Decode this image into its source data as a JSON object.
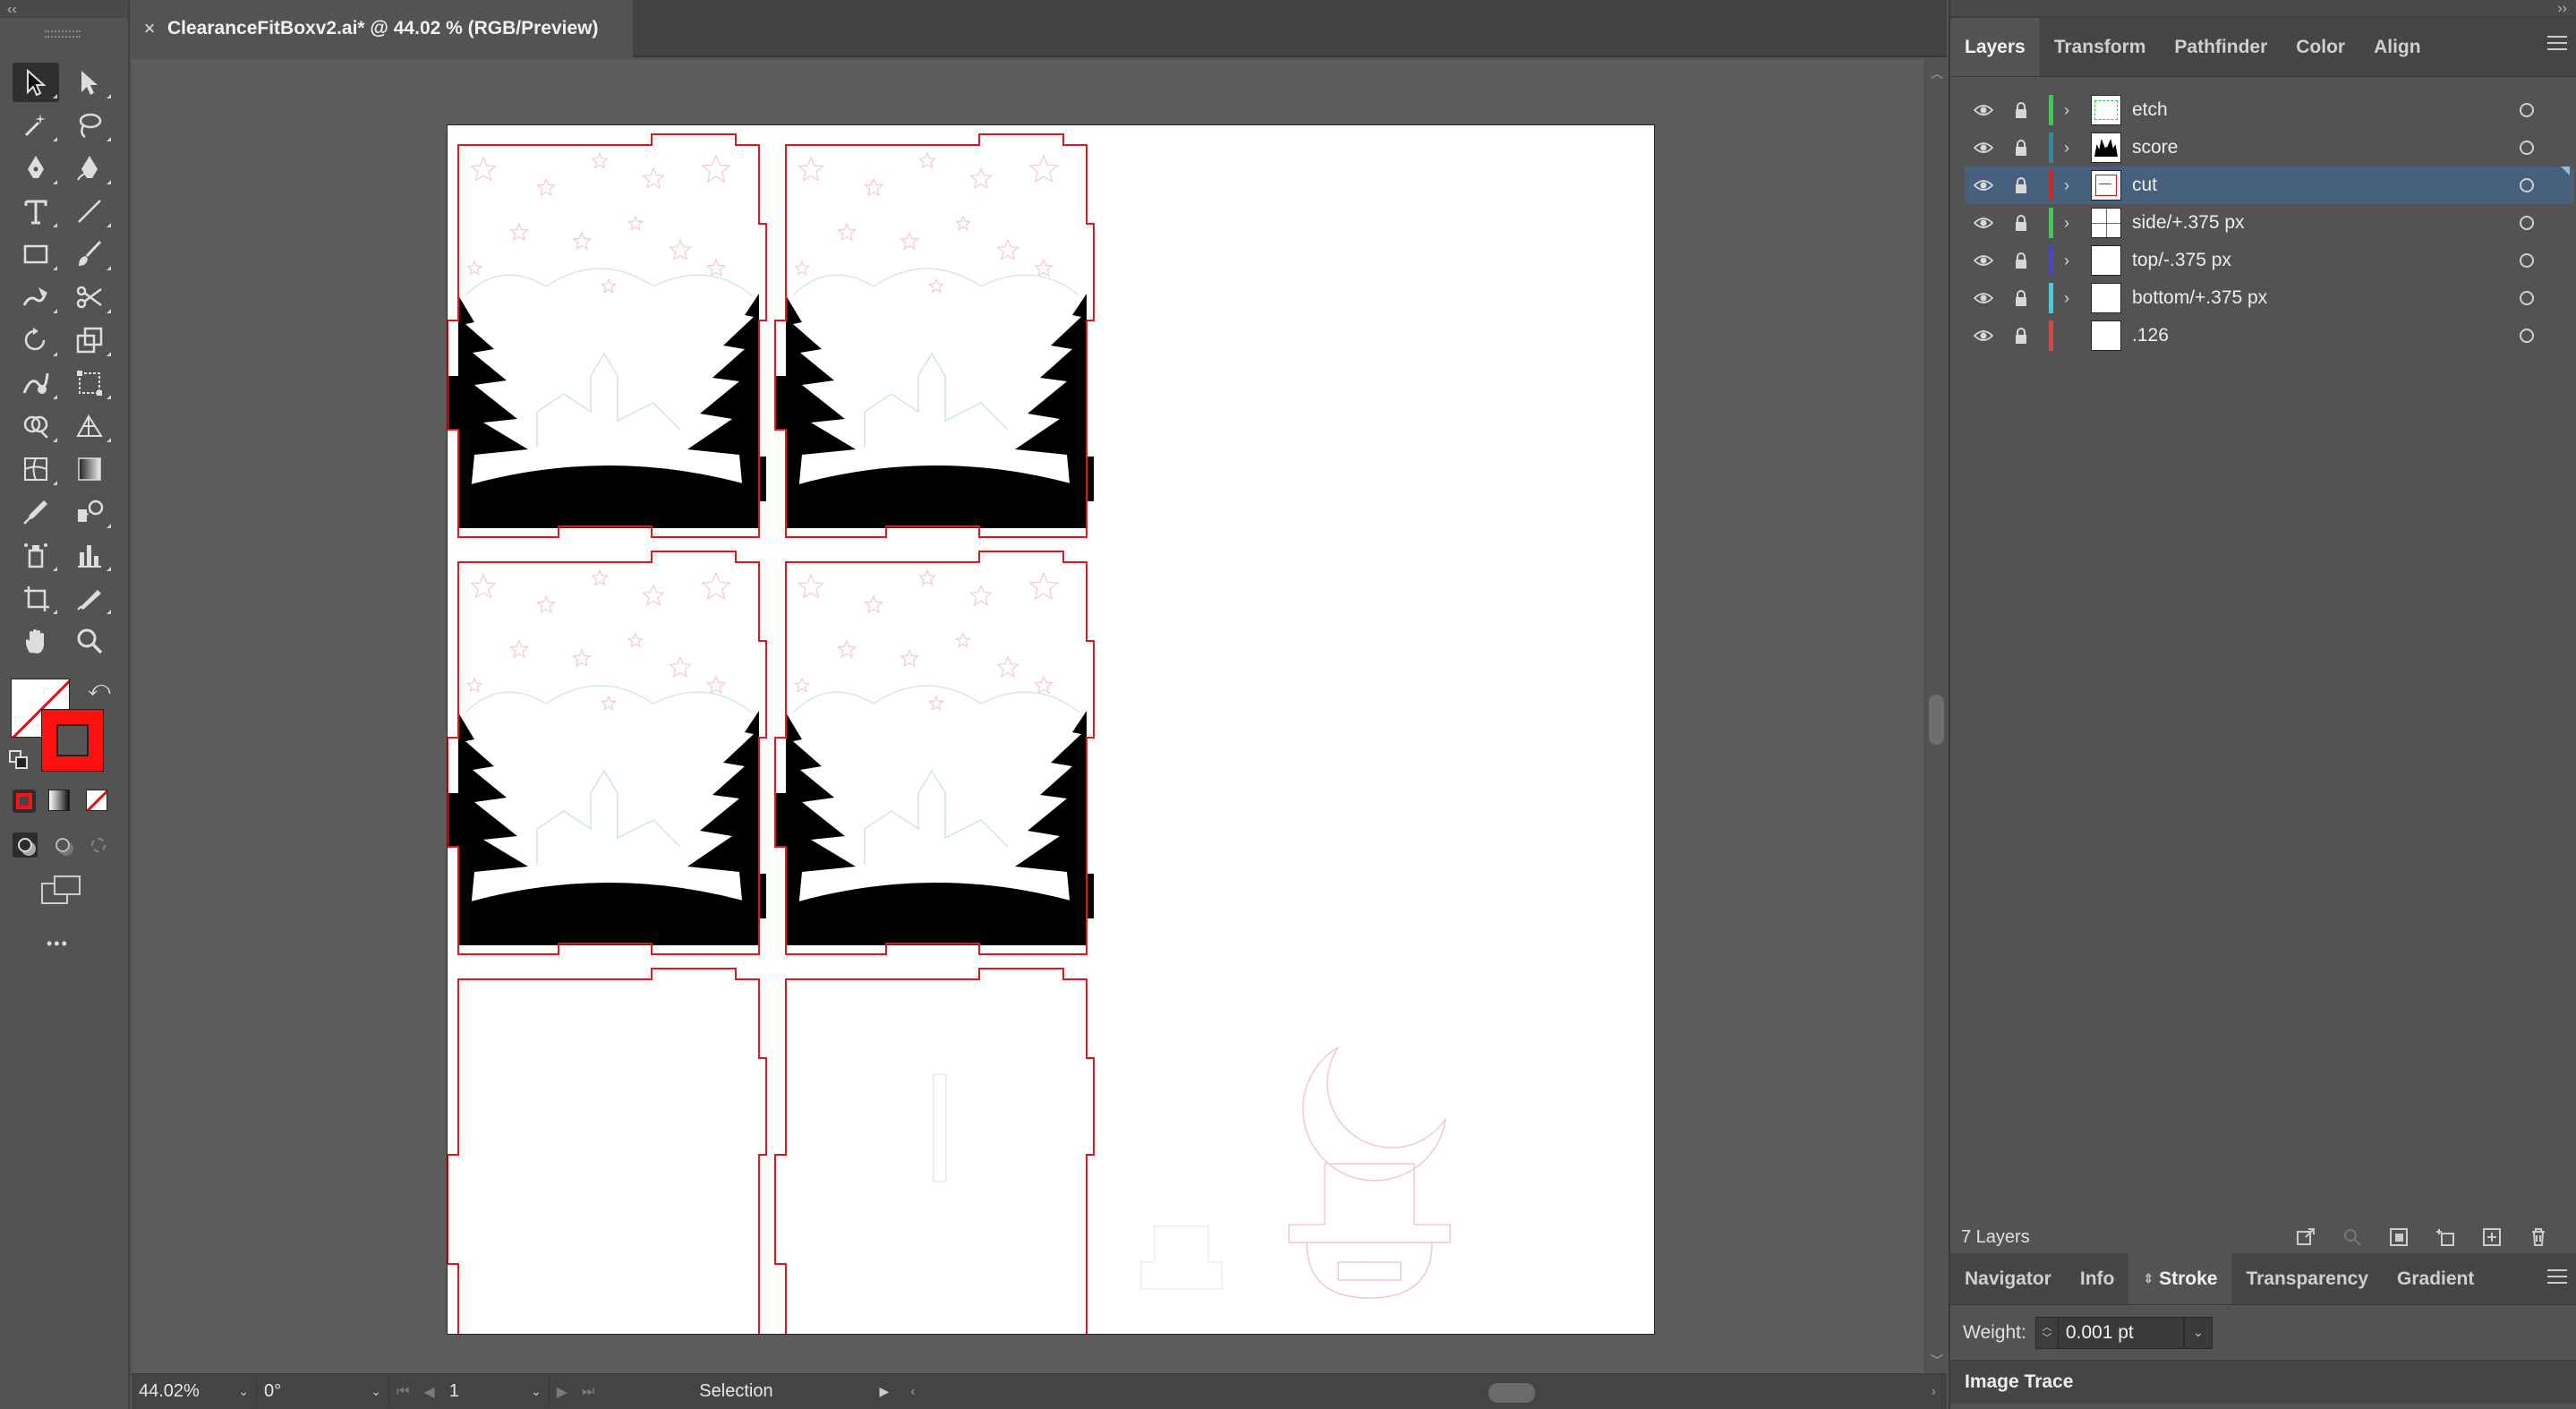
{
  "document": {
    "tab_title": "ClearanceFitBoxv2.ai* @ 44.02 % (RGB/Preview)",
    "close_glyph": "×"
  },
  "window": {
    "left_collapse": "‹‹",
    "right_collapse": "››"
  },
  "statusbar": {
    "zoom": "44.02%",
    "rotation": "0°",
    "artboard_number": "1",
    "mode": "Selection"
  },
  "panels": {
    "top_tabs": [
      "Layers",
      "Transform",
      "Pathfinder",
      "Color",
      "Align"
    ],
    "active_top_tab": "Layers",
    "layers": [
      {
        "name": "etch",
        "color": "#2fd24a",
        "expandable": true,
        "selected": false
      },
      {
        "name": "score",
        "color": "#2a8ca0",
        "expandable": true,
        "selected": false
      },
      {
        "name": "cut",
        "color": "#e02020",
        "expandable": true,
        "selected": true
      },
      {
        "name": "side/+.375 px",
        "color": "#3ad24a",
        "expandable": true,
        "selected": false
      },
      {
        "name": "top/-.375 px",
        "color": "#4444d8",
        "expandable": true,
        "selected": false
      },
      {
        "name": "bottom/+.375 px",
        "color": "#35d4e0",
        "expandable": true,
        "selected": false
      },
      {
        "name": ".126",
        "color": "#e04040",
        "expandable": false,
        "selected": false
      }
    ],
    "layers_count": "7 Layers",
    "bottom_tabs": [
      "Navigator",
      "Info",
      "Stroke",
      "Transparency",
      "Gradient"
    ],
    "active_bottom_tab": "Stroke",
    "stroke": {
      "weight_label": "Weight:",
      "weight_value": "0.001 pt"
    },
    "image_trace_label": "Image Trace"
  },
  "toolbar": {
    "more_label": "•••",
    "tools": [
      "selection-tool",
      "direct-selection-tool",
      "magic-wand-tool",
      "lasso-tool",
      "pen-tool",
      "curvature-tool",
      "type-tool",
      "line-tool",
      "rectangle-tool",
      "paintbrush-tool",
      "shaper-tool",
      "scissors-tool",
      "rotate-tool",
      "scale-tool",
      "warp-tool",
      "free-transform-tool",
      "shape-builder-tool",
      "perspective-grid-tool",
      "mesh-tool",
      "gradient-tool",
      "eyedropper-tool",
      "blend-tool",
      "symbol-sprayer-tool",
      "column-graph-tool",
      "artboard-tool",
      "slice-tool",
      "hand-tool",
      "zoom-tool"
    ]
  },
  "colors": {
    "selection_highlight": "#46607e",
    "stroke_color": "#ff0000",
    "cut_line": "#e8141c"
  }
}
